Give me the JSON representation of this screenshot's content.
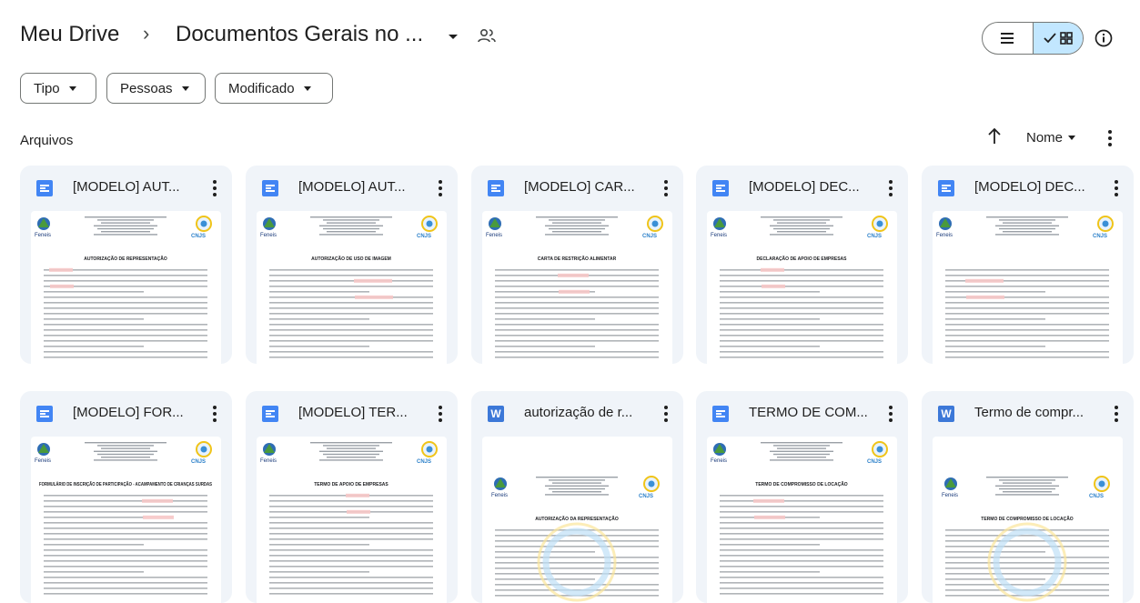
{
  "header": {
    "root": "Meu Drive",
    "separator": "›",
    "current": "Documentos Gerais no ...",
    "view_mode": "grid"
  },
  "filters": [
    {
      "label": "Tipo"
    },
    {
      "label": "Pessoas"
    },
    {
      "label": "Modificado"
    }
  ],
  "section_label": "Arquivos",
  "sort": {
    "label": "Nome"
  },
  "files": [
    {
      "title": "[MODELO] AUT...",
      "type": "doc",
      "heading": "AUTORIZAÇÃO DE REPRESENTAÇÃO"
    },
    {
      "title": "[MODELO] AUT...",
      "type": "doc",
      "heading": "AUTORIZAÇÃO DE USO DE IMAGEM"
    },
    {
      "title": "[MODELO] CAR...",
      "type": "doc",
      "heading": "CARTA DE RESTRIÇÃO ALIMENTAR"
    },
    {
      "title": "[MODELO] DEC...",
      "type": "doc",
      "heading": "DECLARAÇÃO DE APOIO DE EMPRESAS"
    },
    {
      "title": "[MODELO] DEC...",
      "type": "doc",
      "heading": ""
    },
    {
      "title": "[MODELO] FOR...",
      "type": "doc",
      "heading": "FORMULÁRIO DE INSCRIÇÃO DE PARTICIPAÇÃO - ACAMPAMENTO DE CRIANÇAS SURDAS"
    },
    {
      "title": "[MODELO] TER...",
      "type": "doc",
      "heading": "TERMO DE APOIO DE EMPRESAS"
    },
    {
      "title": "autorização de r...",
      "type": "word",
      "word_letter": "W",
      "heading": "AUTORIZAÇÃO DA REPRESENTAÇÃO"
    },
    {
      "title": "TERMO DE COM...",
      "type": "doc",
      "heading": "TERMO DE COMPROMISSO DE LOCAÇÃO"
    },
    {
      "title": "Termo de compr...",
      "type": "word",
      "word_letter": "W",
      "heading": "TERMO DE COMPROMISSO DE LOCAÇÃO"
    }
  ],
  "thumbnail_text": {
    "org_left": "Feneis",
    "org_right": "CNJS"
  },
  "colors": {
    "doc_icon": "#4285f4",
    "word_icon": "#3c78d8",
    "card_bg": "#f0f4f9",
    "toggle_active": "#c2e7ff"
  }
}
